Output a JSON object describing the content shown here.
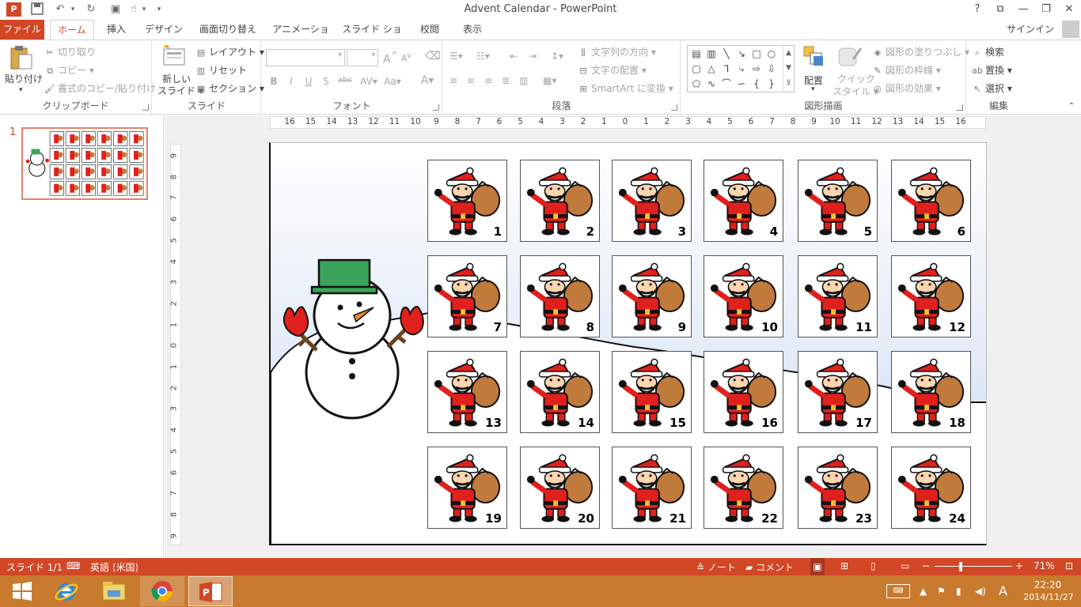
{
  "app": {
    "title": "Advent Calendar - PowerPoint",
    "icon_letter": "P",
    "window_buttons": [
      "?",
      "⧉",
      "—",
      "❐",
      "✕"
    ]
  },
  "quick_access": [
    {
      "name": "save-icon",
      "glyph": "💾"
    },
    {
      "name": "undo-icon",
      "glyph": "↶"
    },
    {
      "name": "redo-icon",
      "glyph": "↻"
    },
    {
      "name": "slideshow-icon",
      "glyph": "▣"
    },
    {
      "name": "touch-mode-icon",
      "glyph": "☝"
    },
    {
      "name": "customize-qat-icon",
      "glyph": "▾"
    }
  ],
  "tabs": {
    "file": "ファイル",
    "items": [
      "ホーム",
      "挿入",
      "デザイン",
      "画面切り替え",
      "アニメーション",
      "スライド ショー",
      "校閲",
      "表示"
    ],
    "active": "ホーム",
    "signin": "サインイン"
  },
  "ribbon": {
    "clipboard": {
      "label": "クリップボード",
      "paste": "貼り付け",
      "cut": "切り取り",
      "copy": "コピー",
      "format_painter": "書式のコピー/貼り付け"
    },
    "slides": {
      "label": "スライド",
      "new_slide_1": "新しい",
      "new_slide_2": "スライド",
      "layout": "レイアウト",
      "reset": "リセット",
      "section": "セクション"
    },
    "font": {
      "label": "フォント",
      "bold": "B",
      "italic": "I",
      "underline": "U",
      "shadow": "S",
      "strike": "abc",
      "spacing": "AV",
      "case": "Aa",
      "color": "A",
      "grow": "A",
      "shrink": "A"
    },
    "paragraph": {
      "label": "段落",
      "text_direction": "文字列の方向",
      "align_text": "文字の配置",
      "smartart": "SmartArt に変換"
    },
    "drawing": {
      "label": "図形描画",
      "arrange": "配置",
      "quick_styles_1": "クイック",
      "quick_styles_2": "スタイル",
      "fill": "図形の塗りつぶし",
      "outline": "図形の枠線",
      "effects": "図形の効果"
    },
    "editing": {
      "label": "編集",
      "find": "検索",
      "replace": "置換",
      "select": "選択"
    }
  },
  "rulers": {
    "h": [
      "16",
      "15",
      "14",
      "13",
      "12",
      "11",
      "10",
      "9",
      "8",
      "7",
      "6",
      "5",
      "4",
      "3",
      "2",
      "1",
      "0",
      "1",
      "2",
      "3",
      "4",
      "5",
      "6",
      "7",
      "8",
      "9",
      "10",
      "11",
      "12",
      "13",
      "14",
      "15",
      "16"
    ],
    "v": [
      "9",
      "8",
      "7",
      "6",
      "5",
      "4",
      "3",
      "2",
      "1",
      "0",
      "1",
      "2",
      "3",
      "4",
      "5",
      "6",
      "7",
      "8",
      "9"
    ]
  },
  "thumbnail": {
    "number": "1"
  },
  "calendar": {
    "days": [
      "1",
      "2",
      "3",
      "4",
      "5",
      "6",
      "7",
      "8",
      "9",
      "10",
      "11",
      "12",
      "13",
      "14",
      "15",
      "16",
      "17",
      "18",
      "19",
      "20",
      "21",
      "22",
      "23",
      "24"
    ]
  },
  "colors": {
    "accent": "#d24726",
    "santa_red": "#e0201c",
    "sack": "#c07a3c",
    "hat_green": "#3aa55a",
    "sky": "#c9daf0"
  },
  "status": {
    "slide": "スライド 1/1",
    "lang": "英語 (米国)",
    "notes": "ノート",
    "comments": "コメント",
    "zoom": "71%"
  },
  "taskbar": {
    "time": "22:20",
    "date": "2014/11/27",
    "ime": "A"
  }
}
